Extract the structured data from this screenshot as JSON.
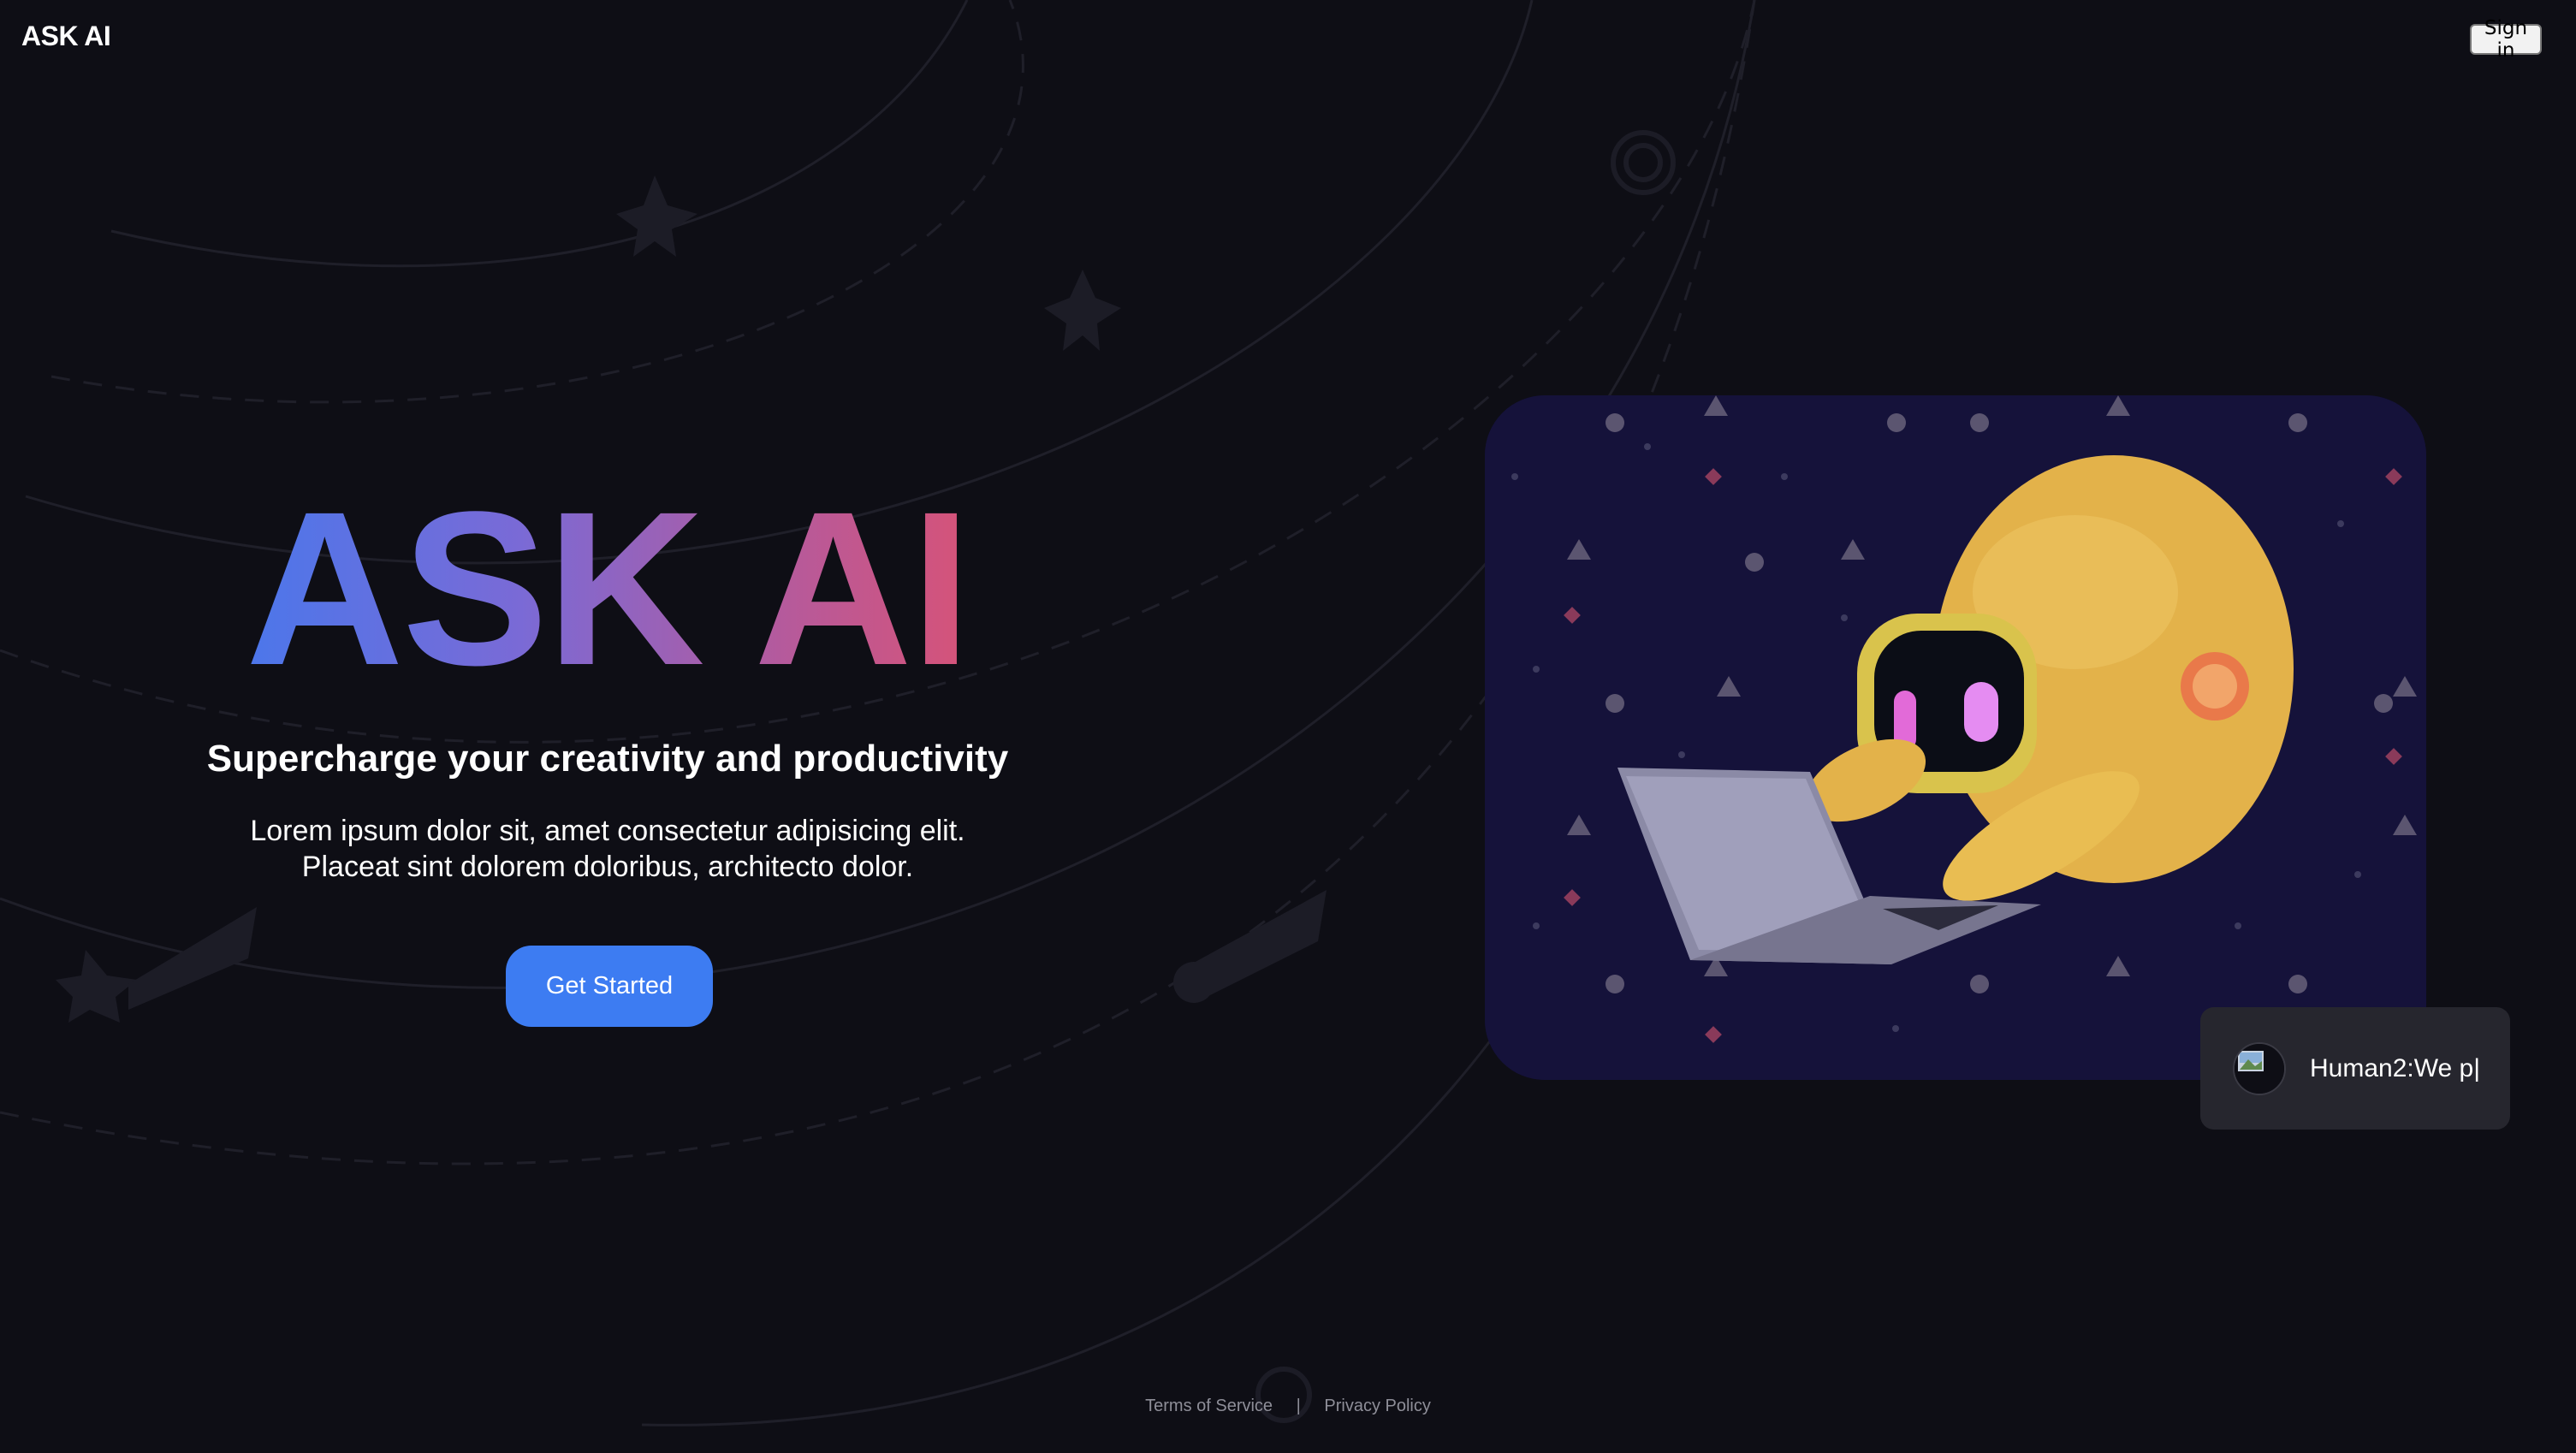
{
  "header": {
    "logo_text": "ASK AI",
    "signin_label": "Sign in"
  },
  "hero": {
    "title": "ASK AI",
    "tagline": "Supercharge your creativity and productivity",
    "description_lines": [
      "Lorem ipsum dolor sit, amet consectetur adipisicing elit.",
      "Placeat sint dolorem doloribus, architecto dolor."
    ],
    "cta_label": "Get Started"
  },
  "illustration": {
    "icon": "robot-with-laptop-illustration"
  },
  "chat_widget": {
    "text": "Human2:We p|"
  },
  "footer": {
    "terms_label": "Terms of Service",
    "separator": "|",
    "privacy_label": "Privacy Policy"
  },
  "colors": {
    "background": "#0e0e15",
    "accent": "#3d7cf2",
    "gradient_start": "#3f7af0",
    "gradient_end": "#e3506a",
    "illustration_bg": "#15123a",
    "robot_body": "#e8b84a"
  }
}
